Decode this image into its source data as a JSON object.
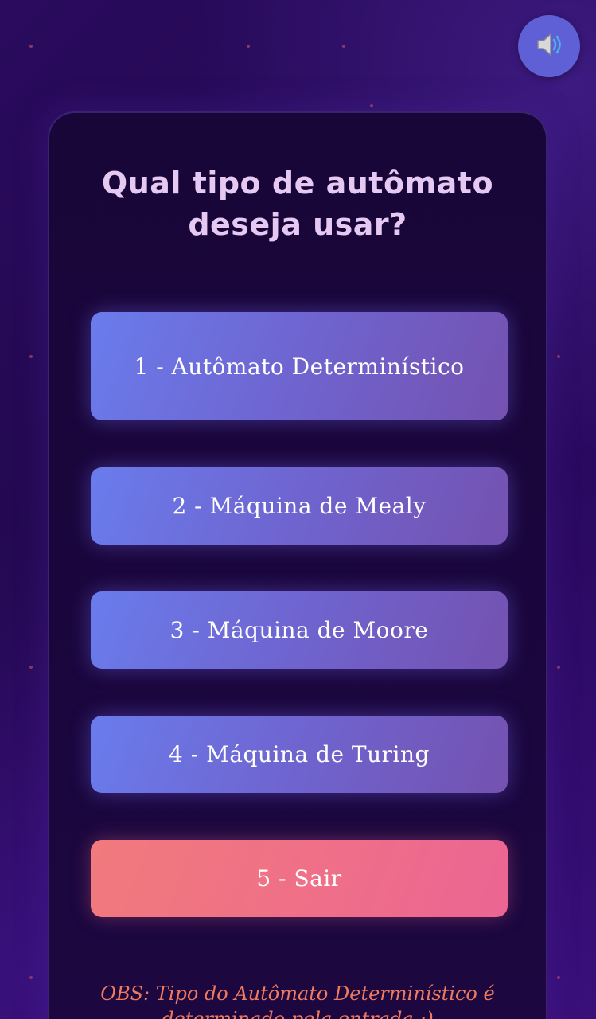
{
  "title": {
    "line1": "Qual tipo de autômato",
    "line2": "deseja usar?"
  },
  "sound_button": {
    "icon": "speaker-icon"
  },
  "menu": {
    "option1": "1 - Autômato Determinístico",
    "option2": "2 - Máquina de Mealy",
    "option3": "3 - Máquina de Moore",
    "option4": "4 - Máquina de Turing",
    "option5": "5 - Sair"
  },
  "note": "OBS: Tipo do Autômato Determinístico é determinado pela entrada :)",
  "colors": {
    "background": "#22084f",
    "card": "#1a0639",
    "title": "#e6c9f2",
    "option_button": "#6f64cf",
    "exit_button": "#ef6f88",
    "note": "#ef7a5e",
    "sound_button": "#5f5fd6"
  }
}
